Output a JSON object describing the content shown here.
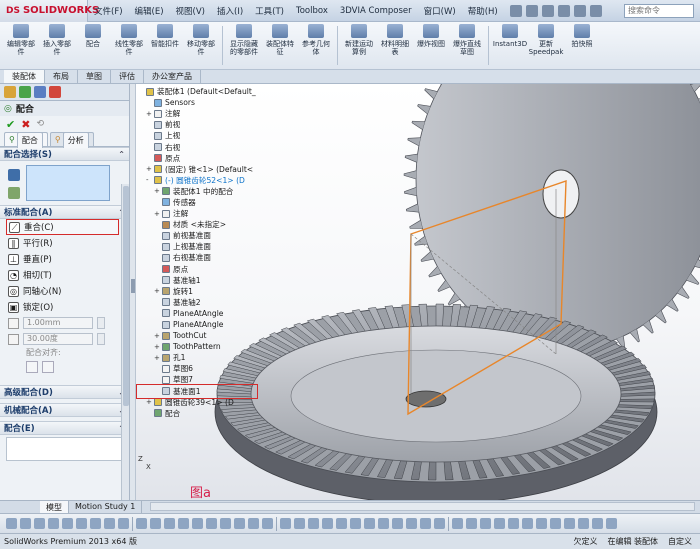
{
  "app": {
    "brand": "SOLIDWORKS",
    "brand_prefix": "DS",
    "search_placeholder": "搜索命令"
  },
  "menu": [
    "文件(F)",
    "编辑(E)",
    "视图(V)",
    "插入(I)",
    "工具(T)",
    "Toolbox",
    "3DVIA Composer",
    "窗口(W)",
    "帮助(H)"
  ],
  "ribbon": [
    {
      "label": "编辑零部件"
    },
    {
      "label": "插入零部件"
    },
    {
      "label": "配合"
    },
    {
      "label": "线性零部件"
    },
    {
      "label": "智能扣件"
    },
    {
      "label": "移动零部件"
    },
    {
      "label": "显示隐藏的零部件"
    },
    {
      "label": "装配体特征"
    },
    {
      "label": "参考几何体"
    },
    {
      "label": "新建运动算例"
    },
    {
      "label": "材料明细表"
    },
    {
      "label": "爆炸视图"
    },
    {
      "label": "爆炸直线草图"
    },
    {
      "label": "Instant3D"
    },
    {
      "label": "更新Speedpak"
    },
    {
      "label": "拍快照"
    }
  ],
  "command_tabs": [
    "装配体",
    "布局",
    "草图",
    "评估",
    "办公室产品"
  ],
  "property_manager": {
    "title": "配合",
    "tab_mates": "配合",
    "tab_analysis": "分析",
    "mate_selections": "配合选择(S)",
    "standard_mates": "标准配合(A)",
    "mates": [
      {
        "label": "重合(C)",
        "icon": "coincident-icon"
      },
      {
        "label": "平行(R)",
        "icon": "parallel-icon"
      },
      {
        "label": "垂直(P)",
        "icon": "perpendicular-icon"
      },
      {
        "label": "相切(T)",
        "icon": "tangent-icon"
      },
      {
        "label": "同轴心(N)",
        "icon": "concentric-icon"
      },
      {
        "label": "锁定(O)",
        "icon": "lock-icon"
      }
    ],
    "distance_value": "1.00mm",
    "angle_value": "30.00度",
    "alignment_label": "配合对齐:",
    "advanced_mates": "高级配合(D)",
    "mechanical_mates": "机械配合(A)",
    "mates_group": "配合(E)"
  },
  "tree": [
    {
      "label": "装配体1 (Default<Default_",
      "exp": "",
      "icon": "assembly-icon"
    },
    {
      "label": "Sensors",
      "exp": "",
      "icon": "sensors-icon"
    },
    {
      "label": "注解",
      "exp": "+",
      "icon": "annotation-icon"
    },
    {
      "label": "前视",
      "exp": "",
      "icon": "plane-icon"
    },
    {
      "label": "上视",
      "exp": "",
      "icon": "plane-icon"
    },
    {
      "label": "右视",
      "exp": "",
      "icon": "plane-icon"
    },
    {
      "label": "原点",
      "exp": "",
      "icon": "origin-icon"
    },
    {
      "label": "(固定) 锥<1> (Default<",
      "exp": "+",
      "icon": "part-icon"
    },
    {
      "label": "(-) 圆锥齿轮52<1> (D",
      "exp": "-",
      "icon": "part-icon",
      "sel": true
    },
    {
      "label": "装配体1 中的配合",
      "exp": "+",
      "icon": "mates-icon"
    },
    {
      "label": "传感器",
      "exp": "",
      "icon": "sensor-icon"
    },
    {
      "label": "注解",
      "exp": "+",
      "icon": "annotation-icon"
    },
    {
      "label": "材质 <未指定>",
      "exp": "",
      "icon": "material-icon"
    },
    {
      "label": "前视基准面",
      "exp": "",
      "icon": "plane-icon"
    },
    {
      "label": "上视基准面",
      "exp": "",
      "icon": "plane-icon"
    },
    {
      "label": "右视基准面",
      "exp": "",
      "icon": "plane-icon"
    },
    {
      "label": "原点",
      "exp": "",
      "icon": "origin-icon"
    },
    {
      "label": "基准轴1",
      "exp": "",
      "icon": "axis-icon"
    },
    {
      "label": "旋转1",
      "exp": "+",
      "icon": "revolve-icon"
    },
    {
      "label": "基准轴2",
      "exp": "",
      "icon": "axis-icon"
    },
    {
      "label": "PlaneAtAngle",
      "exp": "",
      "icon": "plane-icon"
    },
    {
      "label": "PlaneAtAngle",
      "exp": "",
      "icon": "plane-icon"
    },
    {
      "label": "ToothCut",
      "exp": "+",
      "icon": "cut-icon"
    },
    {
      "label": "ToothPattern",
      "exp": "+",
      "icon": "pattern-icon"
    },
    {
      "label": "孔1",
      "exp": "+",
      "icon": "hole-icon"
    },
    {
      "label": "草图6",
      "exp": "",
      "icon": "sketch-icon"
    },
    {
      "label": "草图7",
      "exp": "",
      "icon": "sketch-icon"
    },
    {
      "label": "基准面1",
      "exp": "",
      "icon": "plane-icon",
      "boxed": true
    },
    {
      "label": "圆锥齿轮39<1> (D",
      "exp": "+",
      "icon": "part-icon"
    },
    {
      "label": "配合",
      "exp": "",
      "icon": "mates-icon"
    }
  ],
  "figure_label": "图a",
  "triad_z": "Z",
  "triad_x": "X",
  "model_tabs": [
    "模型",
    "Motion Study 1"
  ],
  "status": {
    "left": "SolidWorks Premium 2013 x64 版",
    "middle": "欠定义",
    "right1": "在编辑 装配体",
    "right2": "自定义"
  },
  "colors": {
    "highlight_red": "#d42b2b",
    "figure_label": "#d61f4a",
    "selection_blue": "#0b72c9",
    "gear_steel": "#9a9ea6",
    "sketch_orange": "#e8862a"
  }
}
